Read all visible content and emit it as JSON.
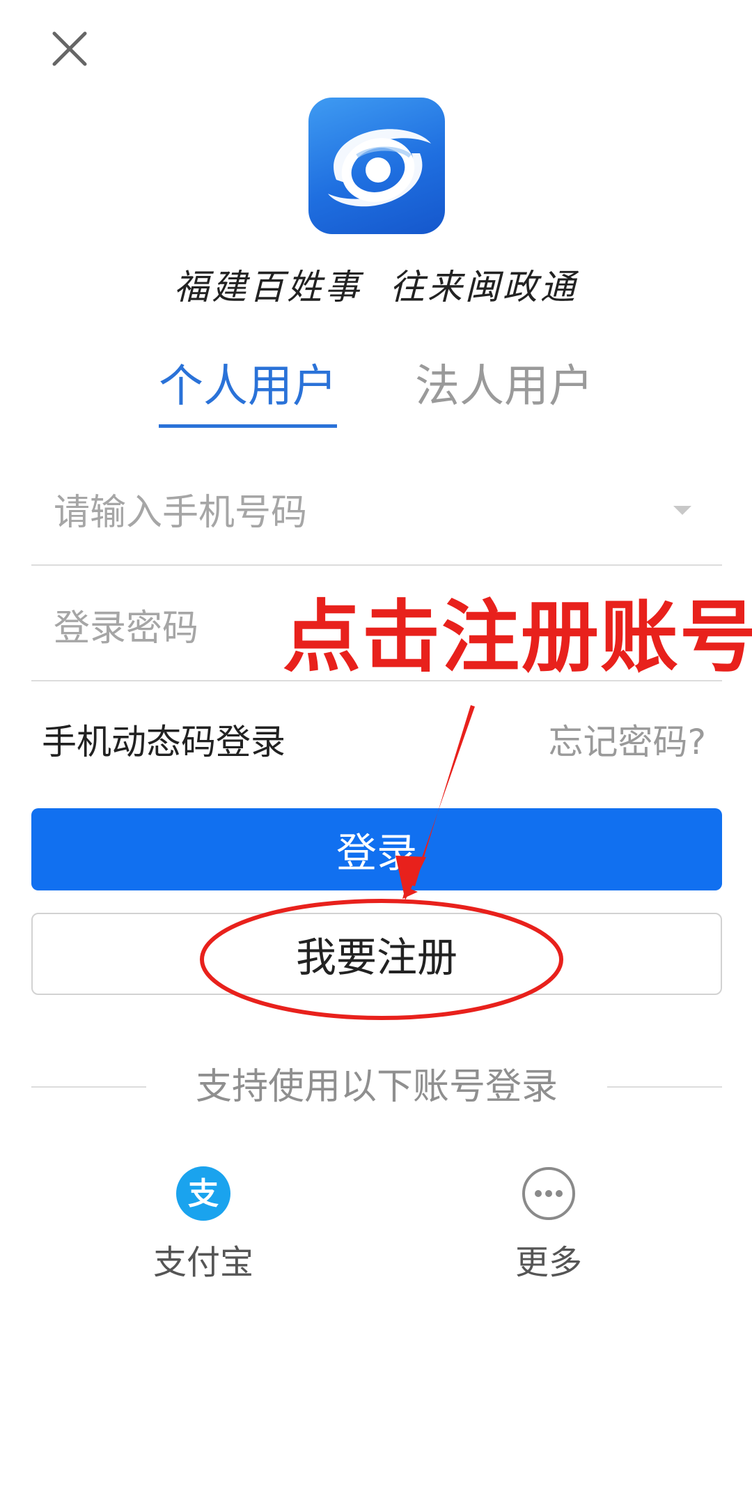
{
  "header": {
    "close_icon": "close-icon"
  },
  "branding": {
    "logo_icon": "app-logo-icon",
    "slogan": "福建百姓事  往来闽政通",
    "brand_color": "#1f6fe0"
  },
  "tabs": {
    "items": [
      {
        "label": "个人用户",
        "active": true
      },
      {
        "label": "法人用户",
        "active": false
      }
    ],
    "active_color": "#2a72d8",
    "inactive_color": "#9a9a9a"
  },
  "form": {
    "phone": {
      "value": "",
      "placeholder": "请输入手机号码",
      "dropdown_icon": "caret-down-icon"
    },
    "password": {
      "value": "",
      "placeholder": "登录密码"
    },
    "sms_login_label": "手机动态码登录",
    "forgot_label": "忘记密码?",
    "login_label": "登录",
    "register_label": "我要注册",
    "primary_color": "#1170f0"
  },
  "third_party": {
    "divider_label": "支持使用以下账号登录",
    "items": [
      {
        "label": "支付宝",
        "icon": "alipay-icon"
      },
      {
        "label": "更多",
        "icon": "more-icon"
      }
    ],
    "alipay_color": "#1aa3ee"
  },
  "annotation": {
    "tip": "点击注册账号",
    "color": "#e8211c"
  }
}
